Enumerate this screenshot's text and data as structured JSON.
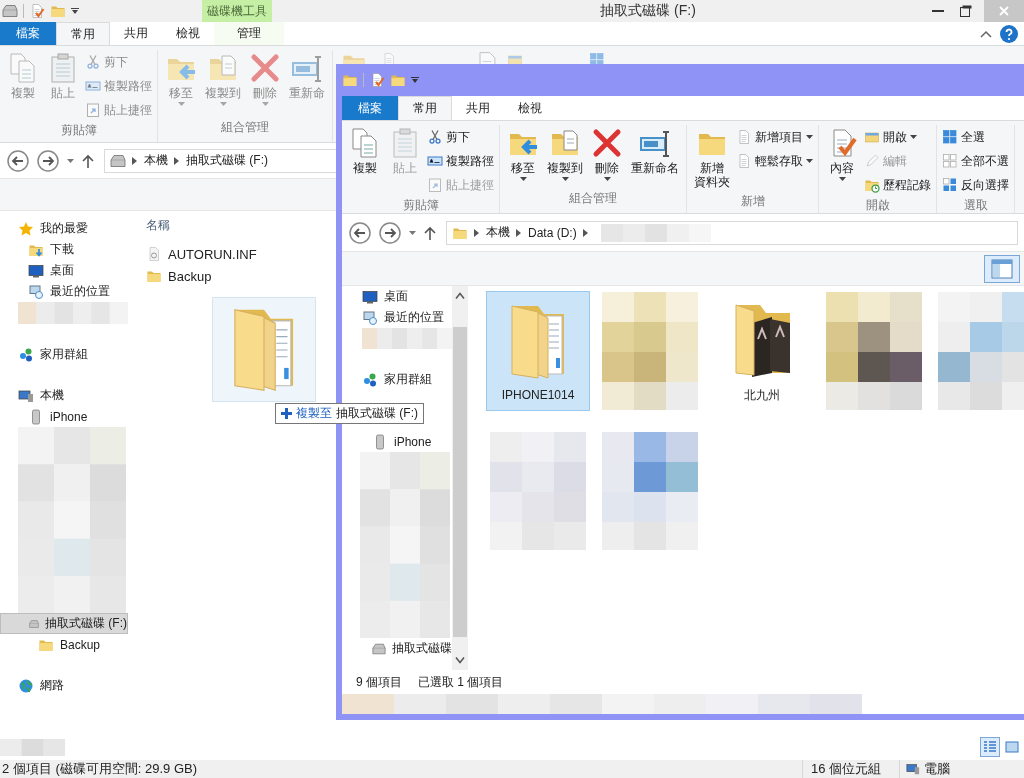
{
  "back_window": {
    "active": false,
    "title": "抽取式磁碟 (F:)",
    "context_label": "磁碟機工具",
    "tabs": [
      {
        "label": "檔案",
        "kind": "file",
        "selected": false
      },
      {
        "label": "常用",
        "kind": "tab",
        "selected": true
      },
      {
        "label": "共用",
        "kind": "tab",
        "selected": false
      },
      {
        "label": "檢視",
        "kind": "tab",
        "selected": false
      },
      {
        "label": "管理",
        "kind": "context",
        "selected": false
      }
    ],
    "ribbon": [
      {
        "name": "剪貼簿",
        "buttons": [
          {
            "label": "複製",
            "kind": "large"
          },
          {
            "label": "貼上",
            "kind": "large"
          },
          {
            "label": "剪下",
            "kind": "small"
          },
          {
            "label": "複製路徑",
            "kind": "small"
          },
          {
            "label": "貼上捷徑",
            "kind": "small"
          }
        ]
      },
      {
        "name": "組合管理",
        "buttons": [
          {
            "label": "移至",
            "kind": "large",
            "dropdown": true
          },
          {
            "label": "複製到",
            "kind": "large",
            "dropdown": true
          },
          {
            "label": "刪除",
            "kind": "large",
            "dropdown": true
          },
          {
            "label": "重新命",
            "kind": "large"
          }
        ]
      }
    ],
    "address": [
      "本機",
      "抽取式磁碟 (F:)"
    ],
    "column": "名稱",
    "files": [
      {
        "name": "AUTORUN.INF",
        "kind": "file"
      },
      {
        "name": "Backup",
        "kind": "folder"
      }
    ],
    "sidebar": [
      {
        "label": "我的最愛",
        "kind": "favorites",
        "selected": false,
        "children": [
          {
            "label": "下載",
            "kind": "downloads",
            "selected": false
          },
          {
            "label": "桌面",
            "kind": "desktop",
            "selected": false
          },
          {
            "label": "最近的位置",
            "kind": "recent",
            "selected": false
          },
          {
            "kind": "blurred",
            "selected": false
          }
        ]
      },
      {
        "label": "家用群組",
        "kind": "homegroup",
        "selected": false
      },
      {
        "label": "本機",
        "kind": "pc",
        "selected": false,
        "children": [
          {
            "label": "iPhone",
            "kind": "phone",
            "selected": false
          },
          {
            "kind": "blurred_block",
            "selected": false
          },
          {
            "label": "抽取式磁碟 (F:)",
            "kind": "drive",
            "selected": true,
            "children": [
              {
                "label": "Backup",
                "kind": "folder",
                "selected": false
              }
            ]
          }
        ]
      },
      {
        "label": "網路",
        "kind": "network",
        "selected": false
      }
    ],
    "views": [
      {
        "kind": "details",
        "selected": true
      },
      {
        "kind": "thumbnails",
        "selected": false
      }
    ],
    "status": {
      "summary": "2 個項目 (磁碟可用空間: 29.9 GB)",
      "size": "16 個位元組",
      "zone": "電腦"
    }
  },
  "drag": {
    "action": "複製至",
    "target": "抽取式磁碟 (F:)"
  },
  "front_window": {
    "active": true,
    "tabs": [
      {
        "label": "檔案",
        "kind": "file",
        "selected": false
      },
      {
        "label": "常用",
        "kind": "tab",
        "selected": true
      },
      {
        "label": "共用",
        "kind": "tab",
        "selected": false
      },
      {
        "label": "檢視",
        "kind": "tab",
        "selected": false
      }
    ],
    "ribbon": [
      {
        "name": "剪貼簿",
        "buttons": [
          {
            "label": "複製",
            "kind": "large",
            "disabled": false
          },
          {
            "label": "貼上",
            "kind": "large",
            "disabled": true
          },
          {
            "label": "剪下",
            "kind": "small",
            "disabled": false
          },
          {
            "label": "複製路徑",
            "kind": "small",
            "disabled": false
          },
          {
            "label": "貼上捷徑",
            "kind": "small",
            "disabled": true
          }
        ]
      },
      {
        "name": "組合管理",
        "buttons": [
          {
            "label": "移至",
            "kind": "large",
            "dropdown": true,
            "disabled": false
          },
          {
            "label": "複製到",
            "kind": "large",
            "dropdown": true,
            "disabled": false
          },
          {
            "label": "刪除",
            "kind": "large",
            "dropdown": true,
            "disabled": false
          },
          {
            "label": "重新命名",
            "kind": "large",
            "disabled": false
          }
        ]
      },
      {
        "name": "新增",
        "buttons": [
          {
            "lines": [
              "新增",
              "資料夾"
            ],
            "kind": "large",
            "disabled": false
          },
          {
            "label": "新增項目",
            "kind": "small",
            "dropdown": true,
            "disabled": false
          },
          {
            "label": "輕鬆存取",
            "kind": "small",
            "dropdown": true,
            "disabled": false
          }
        ]
      },
      {
        "name": "開啟",
        "buttons": [
          {
            "label": "內容",
            "kind": "large",
            "dropdown": true,
            "disabled": false
          },
          {
            "label": "開啟",
            "kind": "small",
            "dropdown": true,
            "disabled": false
          },
          {
            "label": "編輯",
            "kind": "small",
            "disabled": true
          },
          {
            "label": "歷程記錄",
            "kind": "small",
            "disabled": false
          }
        ]
      },
      {
        "name": "選取",
        "buttons": [
          {
            "label": "全選",
            "kind": "small",
            "disabled": false
          },
          {
            "label": "全部不選",
            "kind": "small",
            "disabled": false
          },
          {
            "label": "反向選擇",
            "kind": "small",
            "disabled": false
          }
        ]
      }
    ],
    "address": [
      "本機",
      "Data (D:)"
    ],
    "sidebar": [
      {
        "label": "桌面",
        "kind": "desktop",
        "selected": false
      },
      {
        "label": "最近的位置",
        "kind": "recent",
        "selected": false
      },
      {
        "kind": "blurred",
        "selected": false
      },
      {
        "label": "家用群組",
        "kind": "homegroup",
        "selected": false
      },
      {
        "kind": "pc",
        "selected": false,
        "children": [
          {
            "label": "iPhone",
            "kind": "phone",
            "selected": false
          },
          {
            "kind": "blurred_block",
            "selected": false
          },
          {
            "label": "抽取式磁碟",
            "kind": "drive",
            "selected": false
          }
        ]
      }
    ],
    "items": [
      {
        "name": "IPHONE1014",
        "kind": "folder_docs",
        "selected": true
      },
      {
        "kind": "blurred",
        "selected": false
      },
      {
        "name": "北九州",
        "kind": "folder_photos",
        "selected": false
      },
      {
        "kind": "blurred",
        "selected": false
      },
      {
        "kind": "blurred",
        "selected": false
      },
      {
        "kind": "blurred",
        "selected": false
      },
      {
        "kind": "blurred",
        "selected": false
      }
    ],
    "status": {
      "count": "9 個項目",
      "selection": "已選取 1 個項目"
    }
  }
}
